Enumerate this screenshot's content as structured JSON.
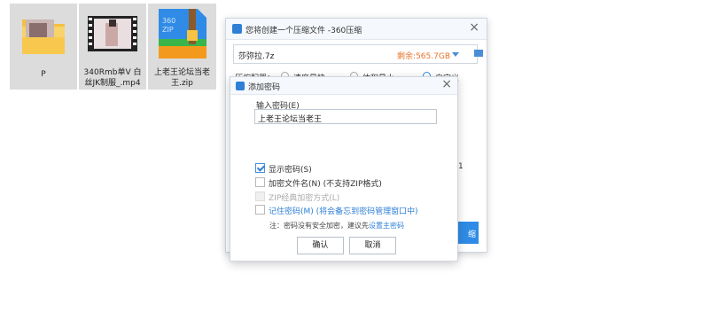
{
  "desktop": {
    "files": [
      {
        "name": "P",
        "type": "folder"
      },
      {
        "name": "340Rmb单V 白丝JK制服_.mp4",
        "line1": "340Rmb单V 白",
        "line2": "丝JK制服_.mp4",
        "type": "video"
      },
      {
        "name": "上老王论坛当老王.zip",
        "line1": "上老王论坛当老",
        "line2": "王.zip",
        "type": "zip",
        "icon_text_top": "360",
        "icon_text_bottom": "ZIP"
      }
    ]
  },
  "zip_dialog": {
    "title": "您将创建一个压缩文件 -360压缩",
    "filename": "莎弥拉.7z",
    "free_space": "剩余:565.7GB",
    "partial_labels": [
      "压缩配置：",
      "速度最快",
      "体积最小",
      "自定义"
    ],
    "side_char": "1",
    "button_fragment": "缩"
  },
  "password_dialog": {
    "title": "添加密码",
    "input_label": "输入密码(E)",
    "password_value": "上老王论坛当老王",
    "options": [
      {
        "label": "显示密码(S)",
        "checked": true,
        "disabled": false
      },
      {
        "label": "加密文件名(N) (不支持ZIP格式)",
        "checked": false,
        "disabled": false
      },
      {
        "label": "ZIP经典加密方式(L)",
        "checked": false,
        "disabled": true
      },
      {
        "label": "记住密码(M) (将会备忘到密码管理窗口中)",
        "checked": false,
        "disabled": false
      }
    ],
    "note_prefix": "注：密码没有安全加密，建议先",
    "note_link": "设置主密码",
    "ok_label": "确认",
    "cancel_label": "取消"
  }
}
